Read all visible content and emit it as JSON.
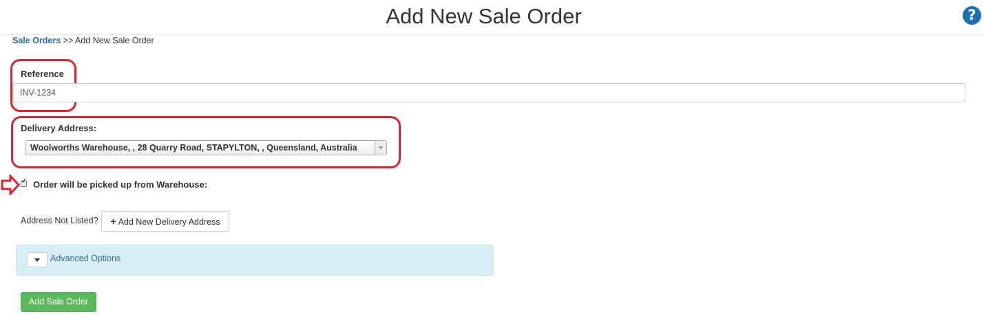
{
  "header": {
    "title": "Add New Sale Order",
    "help_icon": "question-circle-icon",
    "help_glyph": "?"
  },
  "breadcrumb": {
    "parent": "Sale Orders",
    "separator": " >> ",
    "current": "Add New Sale Order"
  },
  "form": {
    "reference": {
      "label": "Reference",
      "value": "INV-1234"
    },
    "delivery_address": {
      "label": "Delivery Address:",
      "selected": "Woolworths Warehouse, , 28 Quarry Road, STAPYLTON, , Queensland, Australia"
    },
    "pickup": {
      "label": "Order will be picked up from Warehouse:",
      "checked": true
    },
    "address_not_listed": {
      "label": "Address Not Listed?",
      "button_label": "Add New Delivery Address",
      "button_icon": "plus-icon"
    },
    "advanced": {
      "label": "Advanced Options"
    },
    "submit_label": "Add Sale Order"
  },
  "colors": {
    "highlight": "#e3202b",
    "link": "#2a6ea6",
    "success": "#5cb85c",
    "panel_bg": "#d9edf7",
    "help_icon": "#1b6fb5"
  }
}
